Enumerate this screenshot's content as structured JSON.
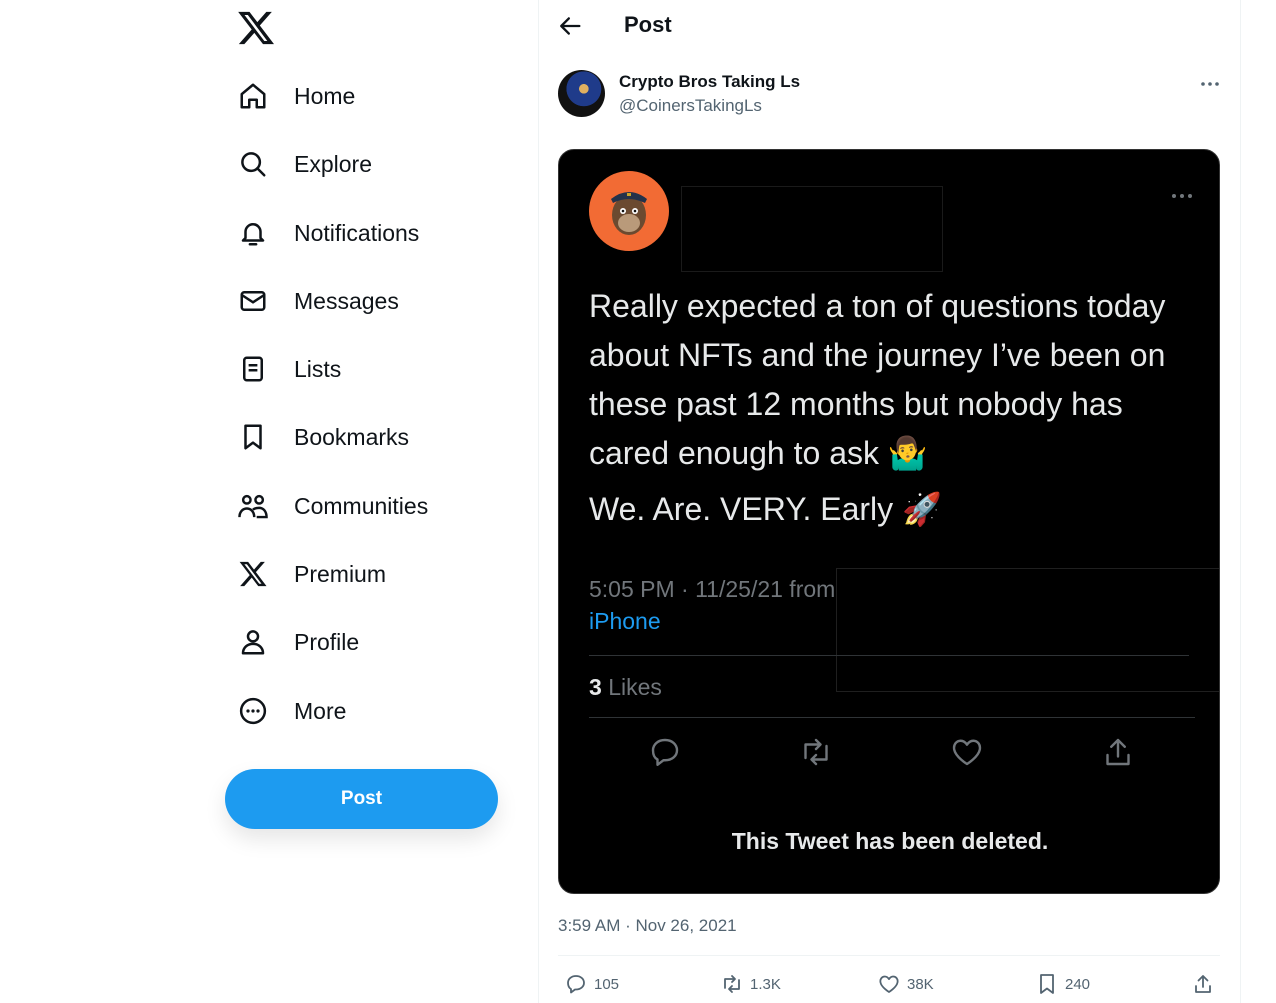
{
  "sidebar": {
    "items": [
      {
        "label": "Home",
        "icon": "home-icon"
      },
      {
        "label": "Explore",
        "icon": "search-icon"
      },
      {
        "label": "Notifications",
        "icon": "bell-icon"
      },
      {
        "label": "Messages",
        "icon": "envelope-icon"
      },
      {
        "label": "Lists",
        "icon": "list-icon"
      },
      {
        "label": "Bookmarks",
        "icon": "bookmark-icon"
      },
      {
        "label": "Communities",
        "icon": "people-icon"
      },
      {
        "label": "Premium",
        "icon": "x-logo-icon"
      },
      {
        "label": "Profile",
        "icon": "person-icon"
      },
      {
        "label": "More",
        "icon": "more-circle-icon"
      }
    ],
    "post_button": "Post"
  },
  "header": {
    "title": "Post"
  },
  "post": {
    "author_name": "Crypto Bros Taking Ls",
    "author_handle": "@CoinersTakingLs",
    "timestamp": "3:59 AM · Nov 26, 2021",
    "actions": {
      "replies": "105",
      "reposts": "1.3K",
      "likes": "38K",
      "bookmarks": "240"
    }
  },
  "embedded_tweet": {
    "text": "Really expected a ton of questions today about NFTs and the journey I’ve been on these past 12 months but nobody has cared enough to ask 🤷‍♂️",
    "text2": "We. Are. VERY. Early 🚀",
    "meta": "5:05 PM · 11/25/21 from",
    "source": "iPhone",
    "likes_count": "3",
    "likes_label": "Likes",
    "deleted_notice": "This Tweet has been deleted."
  },
  "colors": {
    "accent": "#1d9bf0",
    "text": "#0f1419",
    "muted": "#536471",
    "embed_bg": "#000000"
  }
}
